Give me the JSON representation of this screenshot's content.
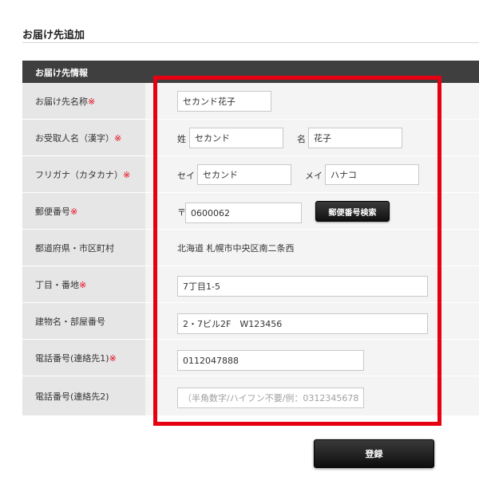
{
  "page": {
    "title": "お届け先追加"
  },
  "section": {
    "title": "お届け先情報"
  },
  "required_mark": "※",
  "colors": {
    "accent": "#e60012",
    "header_bg": "#3f3f3f",
    "label_bg": "#e6e6e6",
    "content_bg": "#f4f4f4"
  },
  "form": {
    "destination_name": {
      "label": "お届け先名称",
      "value": "セカンド花子"
    },
    "recipient_name": {
      "label": "お受取人名（漢字）",
      "last_prefix": "姓",
      "last_value": "セカンド",
      "first_prefix": "名",
      "first_value": "花子"
    },
    "furigana": {
      "label": "フリガナ（カタカナ）",
      "last_prefix": "セイ",
      "last_value": "セカンド",
      "first_prefix": "メイ",
      "first_value": "ハナコ"
    },
    "postal_code": {
      "label": "郵便番号",
      "prefix": "〒",
      "value": "0600062",
      "search_button": "郵便番号検索"
    },
    "prefecture_city": {
      "label": "都道府県・市区町村",
      "value": "北海道 札幌市中央区南二条西"
    },
    "block_number": {
      "label": "丁目・番地",
      "value": "7丁目1-5"
    },
    "building": {
      "label": "建物名・部屋番号",
      "value": "2・7ビル2F　W123456"
    },
    "phone1": {
      "label": "電話番号(連絡先1)",
      "value": "0112047888"
    },
    "phone2": {
      "label": "電話番号(連絡先2)",
      "value": "",
      "placeholder": "（半角数字/ハイフン不要/例：0312345678）"
    }
  },
  "submit": {
    "label": "登録"
  }
}
